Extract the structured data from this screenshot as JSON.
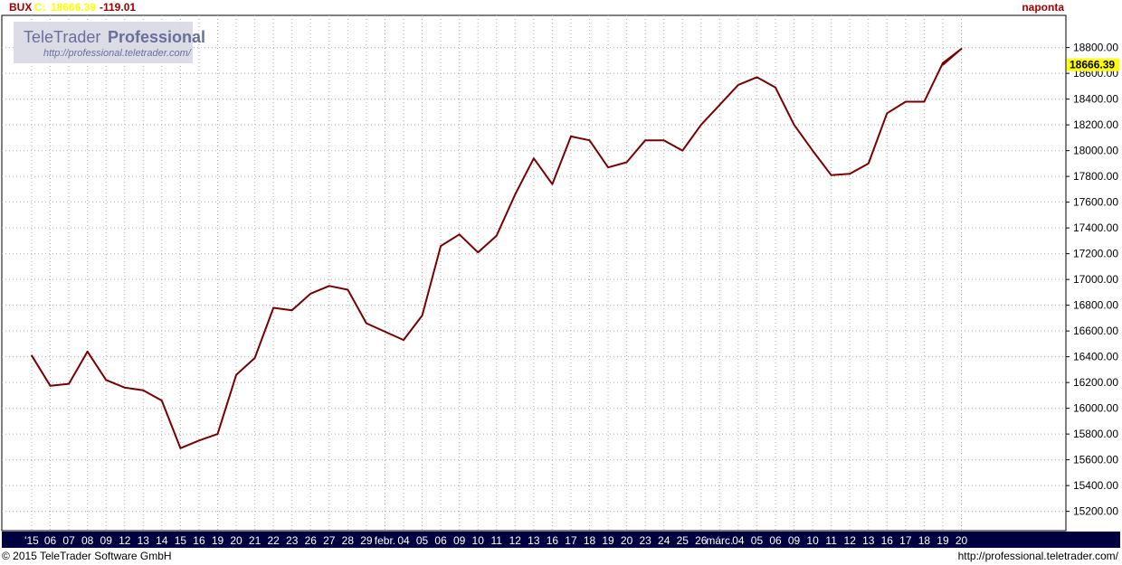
{
  "header": {
    "symbol": "BUX",
    "close_label": "C:",
    "close_value": "18666.39",
    "change": "-119.01",
    "interval": "naponta"
  },
  "watermark": {
    "brand": "TeleTrader",
    "product": "Professional",
    "url": "http://professional.teletrader.com/"
  },
  "footer": {
    "copyright": "© 2015 TeleTrader Software GmbH",
    "url": "http://professional.teletrader.com/"
  },
  "last_price_badge": "18666.39",
  "colors": {
    "line": "#7a0000",
    "badge": "#ffff00",
    "axis_bar": "#000040",
    "grid": "#b0b0b0",
    "header_red": "#a00000",
    "header_yellow": "#ffff00"
  },
  "chart_data": {
    "type": "line",
    "ylim": [
      15050,
      19050
    ],
    "y_ticks": [
      15200,
      15400,
      15600,
      15800,
      16000,
      16200,
      16400,
      16600,
      16800,
      17000,
      17200,
      17400,
      17600,
      17800,
      18000,
      18200,
      18400,
      18600,
      18800
    ],
    "y_tick_labels": [
      "15200.00",
      "15400.00",
      "15600.00",
      "15800.00",
      "16000.00",
      "16200.00",
      "16400.00",
      "16600.00",
      "16800.00",
      "17000.00",
      "17200.00",
      "17400.00",
      "17600.00",
      "17800.00",
      "18000.00",
      "18200.00",
      "18400.00",
      "18600.00",
      "18800.00"
    ],
    "x_labels": [
      "'15",
      "06",
      "07",
      "08",
      "09",
      "12",
      "13",
      "14",
      "15",
      "16",
      "19",
      "20",
      "21",
      "22",
      "23",
      "26",
      "27",
      "28",
      "29",
      "febr.",
      "04",
      "05",
      "06",
      "09",
      "10",
      "11",
      "12",
      "13",
      "16",
      "17",
      "18",
      "19",
      "20",
      "23",
      "24",
      "25",
      "26",
      "márc.",
      "04",
      "05",
      "06",
      "09",
      "10",
      "11",
      "12",
      "13",
      "16",
      "17",
      "18",
      "19",
      "20"
    ],
    "values": [
      16410,
      16175,
      16190,
      16440,
      16220,
      16160,
      16140,
      16060,
      15690,
      15750,
      15800,
      16260,
      16390,
      16780,
      16760,
      16890,
      16950,
      16920,
      16660,
      16530,
      16720,
      17260,
      17350,
      17210,
      17340,
      17660,
      17940,
      17740,
      18110,
      18080,
      17870,
      17910,
      18080,
      18080,
      18000,
      18200,
      18510,
      18570,
      18490,
      18200,
      18000,
      17810,
      17820,
      17900,
      18290,
      18380,
      18380,
      18680,
      18790,
      18666
    ],
    "grid": true
  }
}
